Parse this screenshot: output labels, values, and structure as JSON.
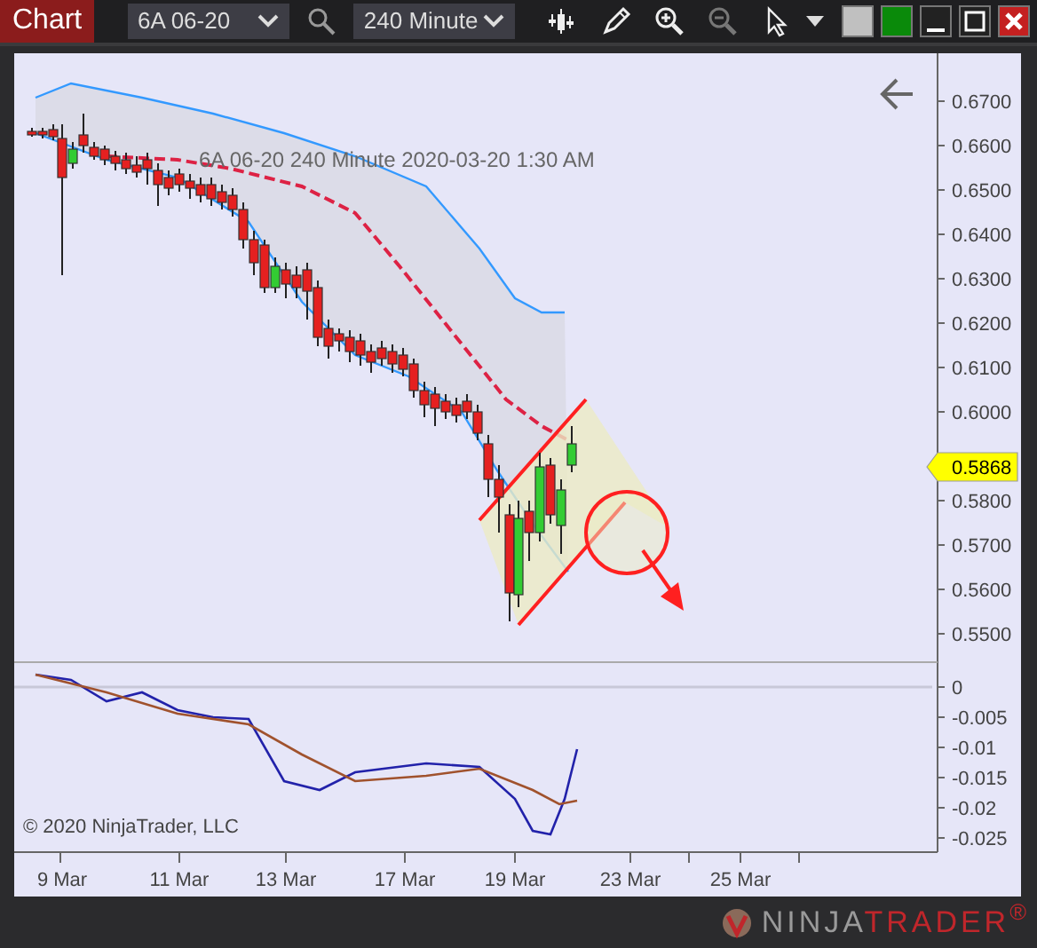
{
  "toolbar": {
    "title": "Chart",
    "instrument": "6A 06-20",
    "interval": "240 Minute",
    "tools": [
      {
        "kind": "bar-type",
        "disabled": false
      },
      {
        "kind": "draw",
        "disabled": false
      },
      {
        "kind": "zoom-in",
        "disabled": false
      },
      {
        "kind": "zoom-out",
        "disabled": true
      },
      {
        "kind": "pointer",
        "disabled": false
      }
    ],
    "window_buttons": [
      {
        "kind": "caret"
      },
      {
        "kind": "swatch",
        "color": "#c0c0c0"
      },
      {
        "kind": "swatch",
        "color": "#0a8a0a"
      },
      {
        "kind": "minimize"
      },
      {
        "kind": "maximize"
      },
      {
        "kind": "close"
      }
    ]
  },
  "chart": {
    "legend": "6A 06-20  240 Minute  2020-03-20 1:30 AM",
    "copyright": "© 2020 NinjaTrader, LLC",
    "price_axis": [
      "0.6700",
      "0.6600",
      "0.6500",
      "0.6400",
      "0.6300",
      "0.6200",
      "0.6100",
      "0.6000",
      "0.5800",
      "0.5700",
      "0.5600",
      "0.5500"
    ],
    "current_price": "0.5868",
    "indicator_axis": [
      "0",
      "-0.005",
      "-0.01",
      "-0.015",
      "-0.02",
      "-0.025"
    ],
    "date_axis": [
      "9 Mar",
      "11 Mar",
      "13 Mar",
      "17 Mar",
      "19 Mar",
      "23 Mar",
      "25 Mar"
    ]
  },
  "footer": {
    "brand_first": "NINJA",
    "brand_second": "TRADER$^{®}$"
  }
}
